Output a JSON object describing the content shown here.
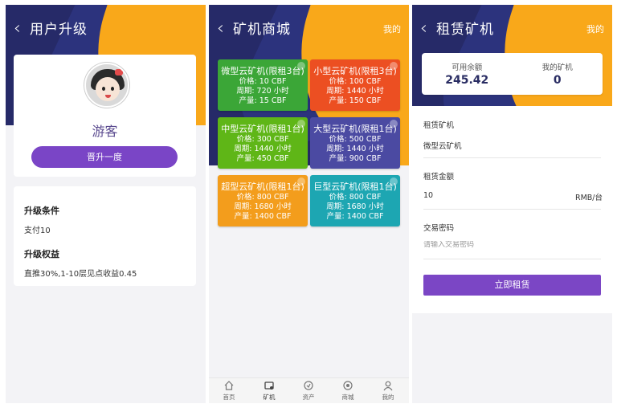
{
  "panel1": {
    "title": "用户升级",
    "username": "游客",
    "upgrade_button": "晋升一度",
    "condition_heading": "升级条件",
    "condition_value": "支付10",
    "benefit_heading": "升级权益",
    "benefit_value": "直推30%,1-10层见点收益0.45"
  },
  "panel2": {
    "title": "矿机商城",
    "mine_link": "我的",
    "machines": [
      {
        "name": "微型云矿机(限租3台)",
        "price": "价格:  10 CBF",
        "period": "周期:  720 小时",
        "output": "产量:  15 CBF",
        "color": "#3ba637"
      },
      {
        "name": "小型云矿机(限租3台)",
        "price": "价格:  100 CBF",
        "period": "周期:  1440 小时",
        "output": "产量:  150 CBF",
        "color": "#ec4f22"
      },
      {
        "name": "中型云矿机(限租1台)",
        "price": "价格:  300 CBF",
        "period": "周期:  1440 小时",
        "output": "产量:  450 CBF",
        "color": "#5fb617"
      },
      {
        "name": "大型云矿机(限租1台)",
        "price": "价格:  500 CBF",
        "period": "周期:  1440 小时",
        "output": "产量:  900 CBF",
        "color": "#4b4aa2"
      },
      {
        "name": "超型云矿机(限租1台)",
        "price": "价格:  800 CBF",
        "period": "周期:  1680 小时",
        "output": "产量:  1400 CBF",
        "color": "#f39d1c"
      },
      {
        "name": "巨型云矿机(限租1台)",
        "price": "价格:  800 CBF",
        "period": "周期:  1680 小时",
        "output": "产量:  1400 CBF",
        "color": "#1da6b2"
      }
    ],
    "tabs": [
      {
        "label": "首页",
        "icon": "home-icon"
      },
      {
        "label": "矿机",
        "icon": "miner-icon"
      },
      {
        "label": "资产",
        "icon": "assets-icon"
      },
      {
        "label": "商城",
        "icon": "shop-icon"
      },
      {
        "label": "我的",
        "icon": "user-icon"
      }
    ]
  },
  "panel3": {
    "title": "租赁矿机",
    "mine_link": "我的",
    "balance_label": "可用余额",
    "balance_value": "245.42",
    "my_miners_label": "我的矿机",
    "my_miners_value": "0",
    "field_machine_label": "租赁矿机",
    "field_machine_value": "微型云矿机",
    "field_amount_label": "租赁金额",
    "field_amount_value": "10",
    "field_amount_unit": "RMB/台",
    "field_password_label": "交易密码",
    "field_password_placeholder": "请输入交易密码",
    "submit_button": "立即租赁"
  },
  "colors": {
    "header_navy": "#262a68",
    "header_orange": "#f9a81a",
    "accent_purple": "#7a45c6"
  }
}
